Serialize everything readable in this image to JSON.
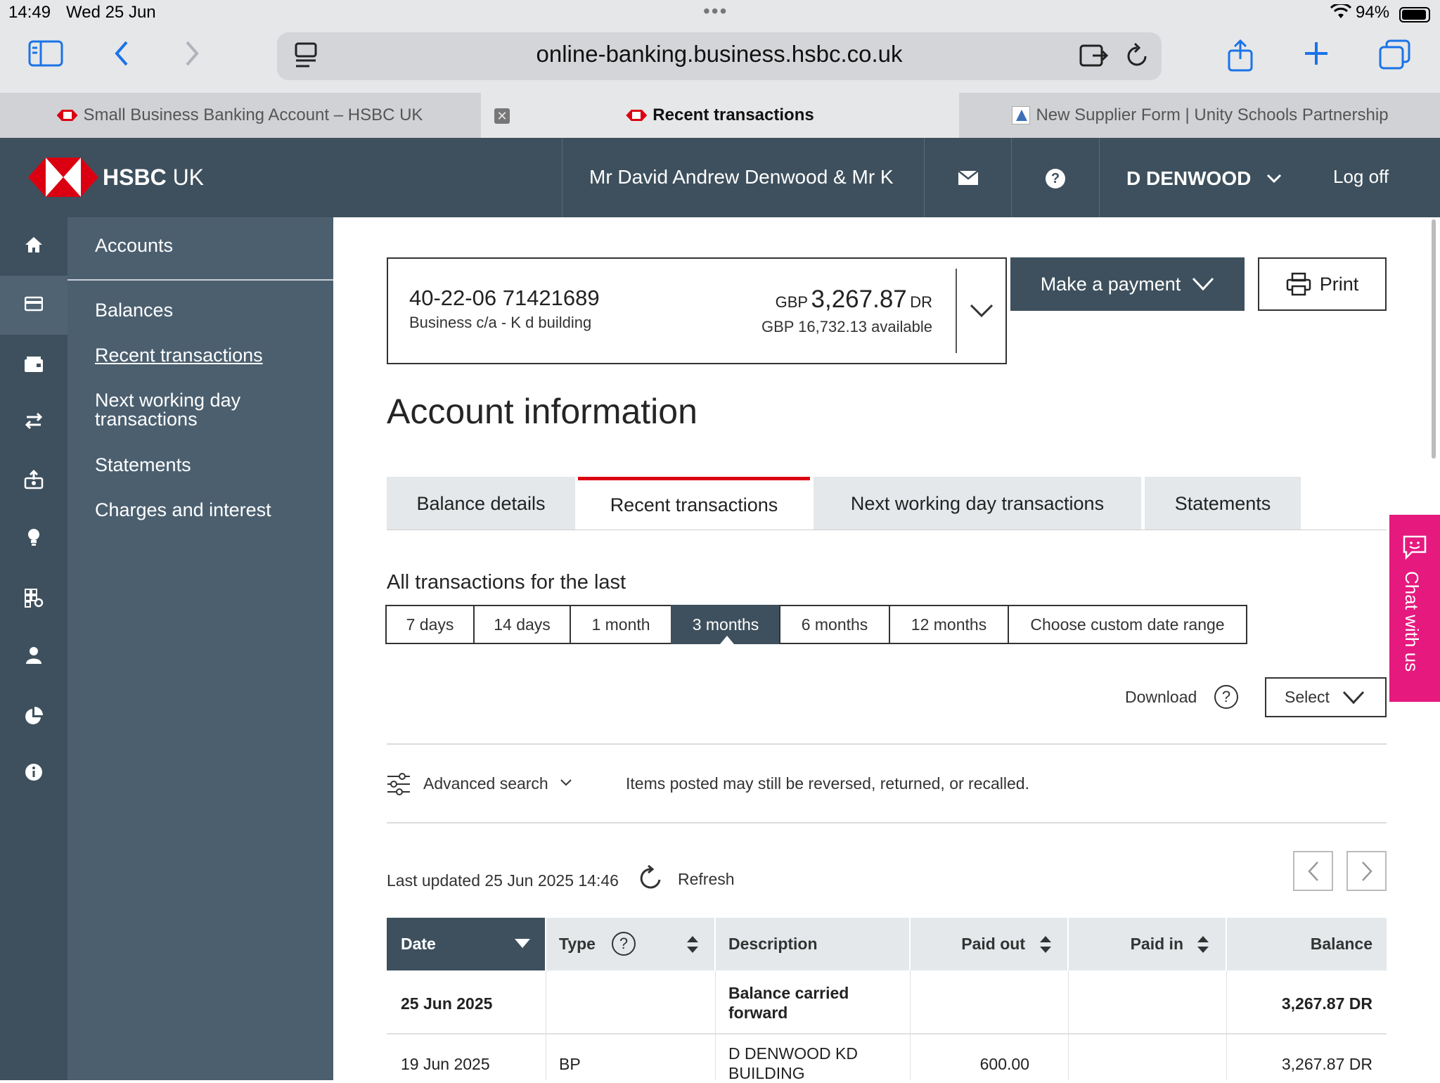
{
  "status_bar": {
    "time": "14:49",
    "date": "Wed 25 Jun",
    "battery": "94%"
  },
  "browser": {
    "url": "online-banking.business.hsbc.co.uk",
    "tabs": [
      {
        "title": "Small Business Banking Account – HSBC UK"
      },
      {
        "title": "Recent transactions",
        "active": true
      },
      {
        "title": "New Supplier Form | Unity Schools Partnership"
      }
    ]
  },
  "header": {
    "brand": "HSBC",
    "brand_suffix": "UK",
    "customer_name": "Mr David Andrew Denwood & Mr K",
    "user": "D DENWOOD",
    "logoff": "Log off"
  },
  "subnav": {
    "heading": "Accounts",
    "items": [
      {
        "label": "Balances"
      },
      {
        "label": "Recent transactions",
        "active": true
      },
      {
        "label": "Next working day transactions"
      },
      {
        "label": "Statements"
      },
      {
        "label": "Charges and interest"
      }
    ]
  },
  "account": {
    "number": "40-22-06 71421689",
    "name": "Business c/a - K d building",
    "currency": "GBP",
    "balance": "3,267.87",
    "balance_suffix": "DR",
    "available": "GBP 16,732.13 available"
  },
  "actions": {
    "make_payment": "Make a payment",
    "print": "Print"
  },
  "page_title": "Account information",
  "tabs": [
    {
      "label": "Balance details"
    },
    {
      "label": "Recent transactions",
      "active": true
    },
    {
      "label": "Next working day transactions"
    },
    {
      "label": "Statements"
    }
  ],
  "range": {
    "label": "All transactions for the last",
    "options": [
      "7 days",
      "14 days",
      "1 month",
      "3 months",
      "6 months",
      "12 months",
      "Choose custom date range"
    ],
    "selected": "3 months"
  },
  "download": {
    "label": "Download",
    "help": "?",
    "select": "Select"
  },
  "advanced_search": {
    "label": "Advanced search",
    "note": "Items posted may still be reversed, returned, or recalled."
  },
  "last_updated": "Last updated 25 Jun 2025 14:46",
  "refresh": "Refresh",
  "table": {
    "columns": [
      "Date",
      "Type",
      "Description",
      "Paid out",
      "Paid in",
      "Balance"
    ],
    "type_help": "?",
    "rows": [
      {
        "date": "25 Jun 2025",
        "type": "",
        "description": "Balance carried forward",
        "paid_out": "",
        "paid_in": "",
        "balance": "3,267.87 DR"
      },
      {
        "date": "19 Jun 2025",
        "type": "BP",
        "description": "D DENWOOD KD BUILDING",
        "paid_out": "600.00",
        "paid_in": "",
        "balance": "3,267.87 DR"
      }
    ]
  },
  "chat": {
    "label": "Chat with us"
  },
  "colors": {
    "hsbc_red": "#db0011",
    "header": "#3e505d",
    "sidebar": "#4b5f6f",
    "chat": "#e5197e",
    "safari_blue": "#1a73e8"
  }
}
